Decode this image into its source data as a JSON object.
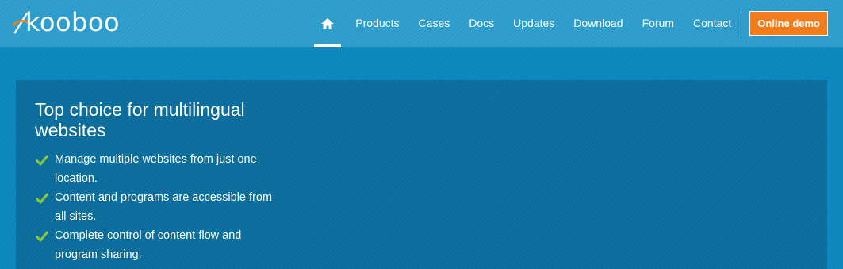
{
  "header": {
    "logo_text": "kooboo",
    "nav": [
      {
        "label": "Products"
      },
      {
        "label": "Cases"
      },
      {
        "label": "Docs"
      },
      {
        "label": "Updates"
      },
      {
        "label": "Download"
      },
      {
        "label": "Forum"
      },
      {
        "label": "Contact"
      }
    ],
    "home_icon": "home-icon",
    "cta_label": "Online demo"
  },
  "hero": {
    "title": "Top choice for multilingual websites",
    "features": [
      {
        "icon": "check-icon",
        "text": "Manage multiple websites from just one location."
      },
      {
        "icon": "check-icon",
        "text": "Content and programs are accessible from all sites."
      },
      {
        "icon": "check-icon",
        "text": "Complete control of content flow and program sharing."
      }
    ]
  },
  "colors": {
    "header_bg": "#2b9ccc",
    "page_bg": "#0a87bd",
    "hero_bg": "#0a6d9b",
    "cta_bg": "#f47c1c",
    "check": "#8cc63f",
    "logo_accent": "#f47c1c"
  }
}
